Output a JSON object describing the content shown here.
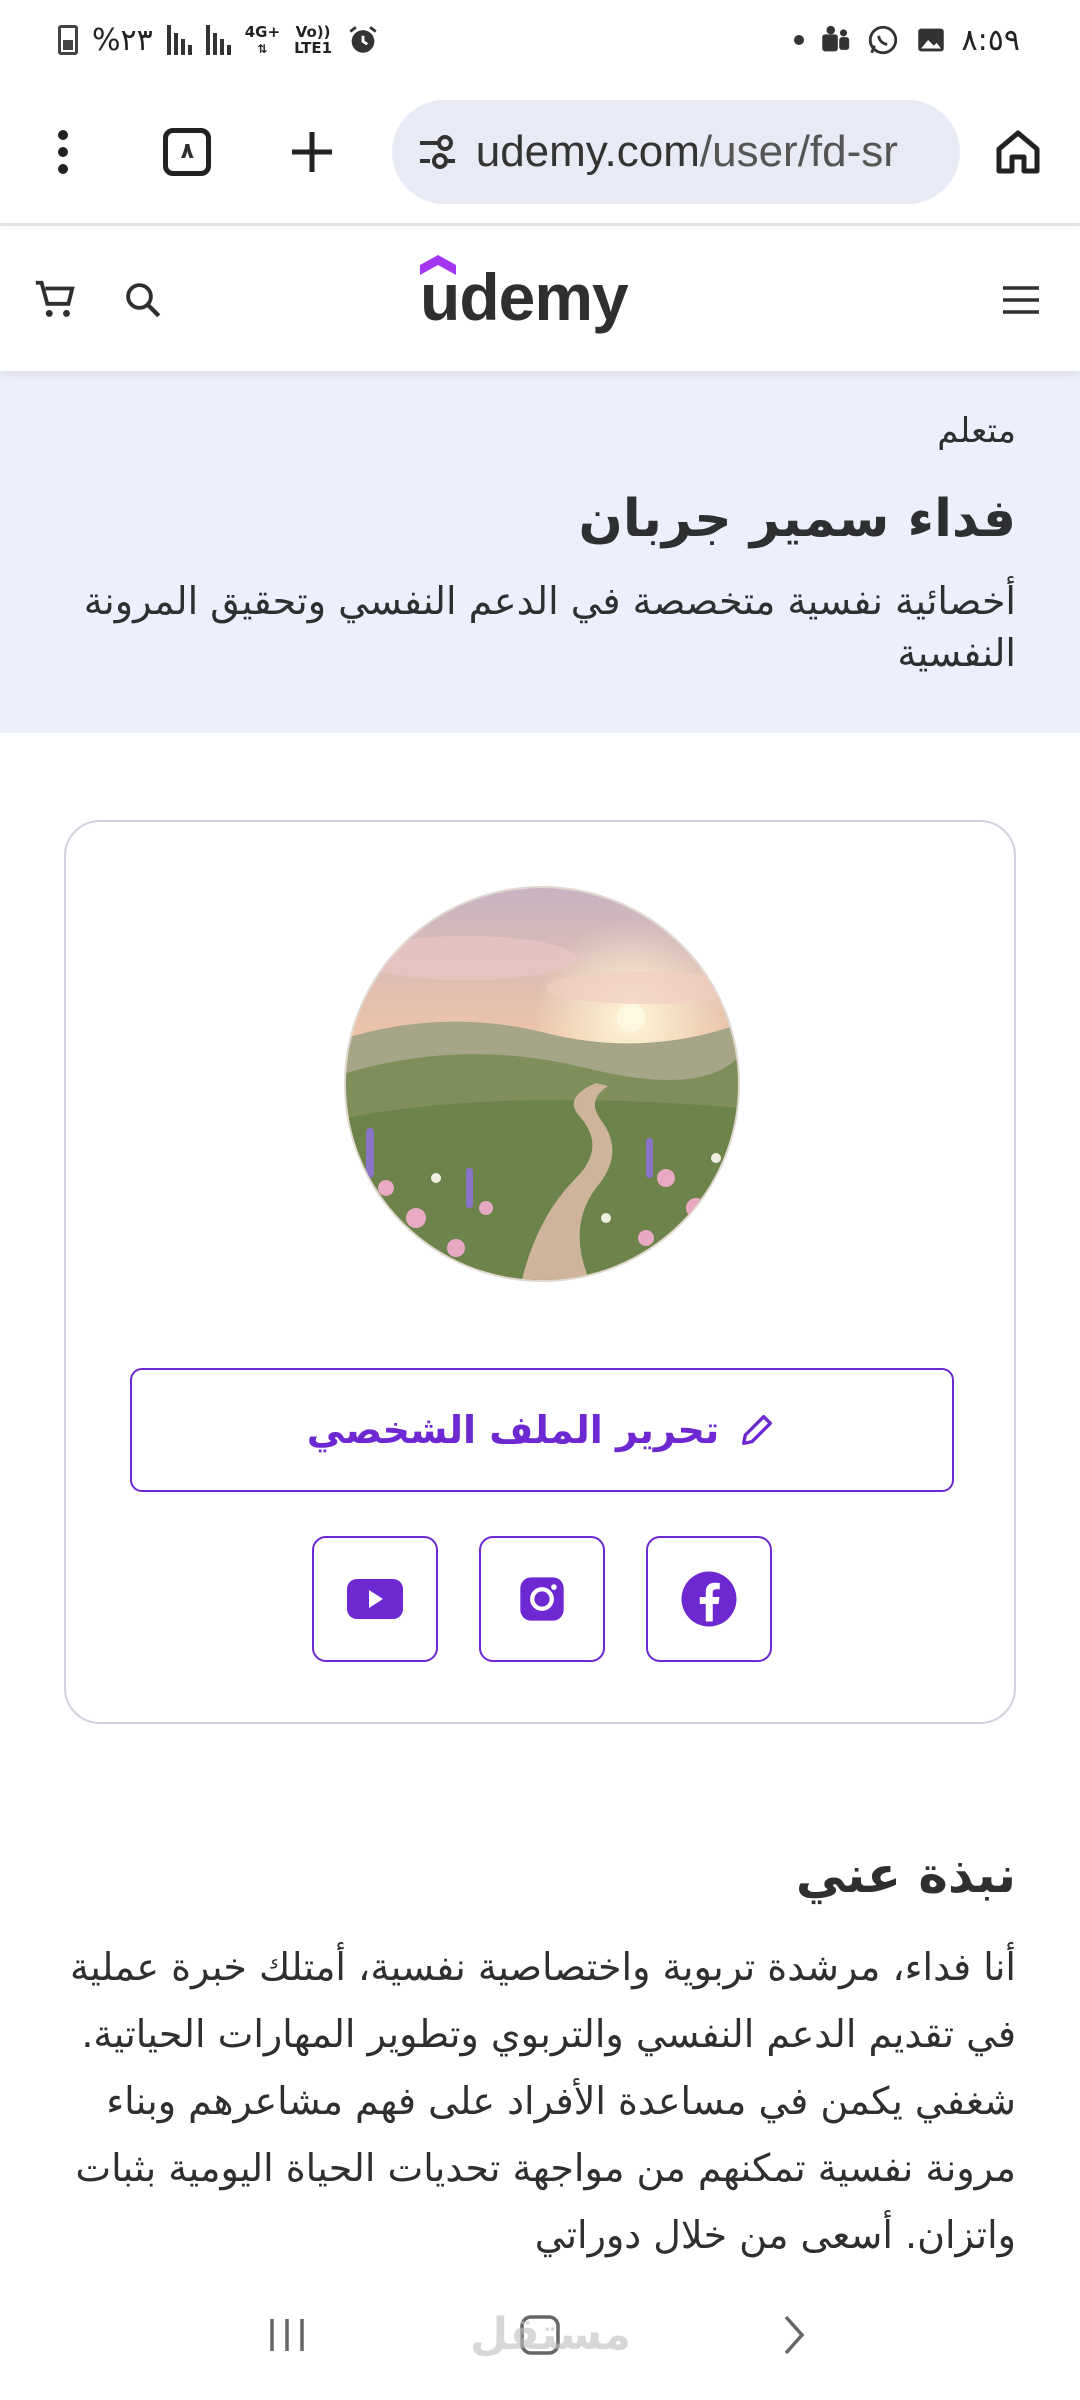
{
  "status_bar": {
    "time": "٨:٥٩",
    "battery": "%٢٣",
    "network_top": "4G+",
    "network_bottom": "LTE1",
    "volte": "Vo))"
  },
  "browser": {
    "url_host": "udemy.com",
    "url_path": "/user/fd-sr",
    "tab_count": "٨"
  },
  "site": {
    "logo": "udemy",
    "accent_color": "#6d28d2"
  },
  "profile": {
    "role": "متعلم",
    "name": "فداء سمير جربان",
    "headline": "أخصائية نفسية متخصصة في الدعم النفسي وتحقيق المرونة النفسية",
    "edit_button": "تحرير الملف الشخصي",
    "socials": [
      {
        "name": "facebook",
        "icon": "facebook-icon"
      },
      {
        "name": "instagram",
        "icon": "instagram-icon"
      },
      {
        "name": "youtube",
        "icon": "youtube-icon"
      }
    ]
  },
  "about": {
    "title": "نبذة عني",
    "text": "أنا فداء، مرشدة تربوية واختصاصية نفسية، أمتلك خبرة عملية في تقديم الدعم النفسي والتربوي وتطوير المهارات الحياتية. شغفي يكمن في مساعدة الأفراد على فهم مشاعرهم وبناء مرونة نفسية تمكنهم من مواجهة تحديات الحياة اليومية بثبات واتزان. أسعى من خلال دوراتي"
  },
  "watermark": "مستقل"
}
